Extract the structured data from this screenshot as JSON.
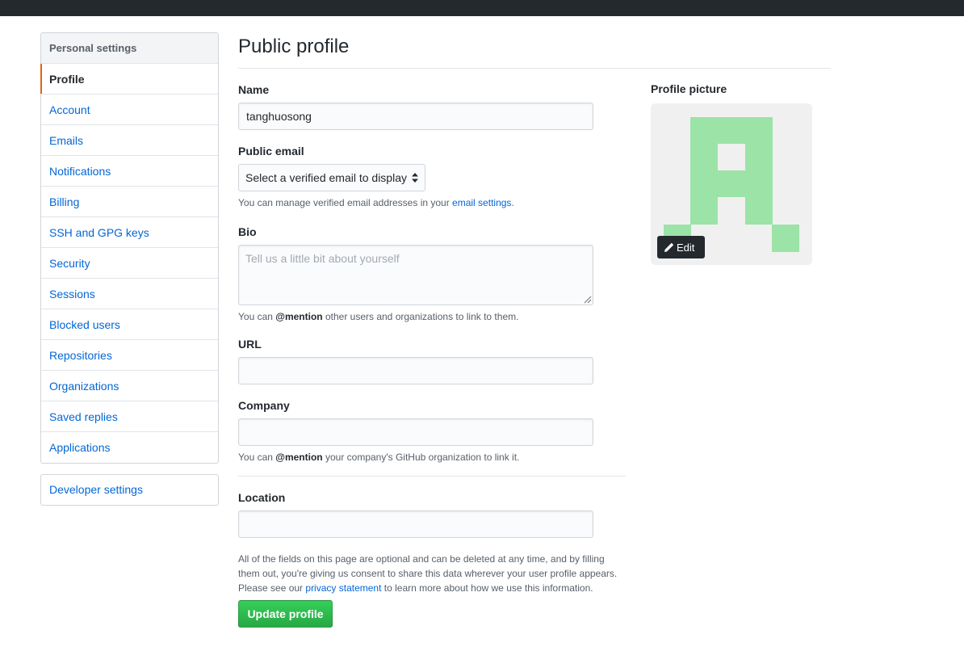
{
  "sidebar": {
    "heading": "Personal settings",
    "items": [
      {
        "label": "Profile"
      },
      {
        "label": "Account"
      },
      {
        "label": "Emails"
      },
      {
        "label": "Notifications"
      },
      {
        "label": "Billing"
      },
      {
        "label": "SSH and GPG keys"
      },
      {
        "label": "Security"
      },
      {
        "label": "Sessions"
      },
      {
        "label": "Blocked users"
      },
      {
        "label": "Repositories"
      },
      {
        "label": "Organizations"
      },
      {
        "label": "Saved replies"
      },
      {
        "label": "Applications"
      }
    ],
    "developer_settings": "Developer settings"
  },
  "main": {
    "title": "Public profile",
    "name": {
      "label": "Name",
      "value": "tanghuosong"
    },
    "public_email": {
      "label": "Public email",
      "selected": "Select a verified email to display",
      "note_prefix": "You can manage verified email addresses in your ",
      "note_link": "email settings",
      "note_suffix": "."
    },
    "bio": {
      "label": "Bio",
      "placeholder": "Tell us a little bit about yourself",
      "note_prefix": "You can ",
      "note_mention": "@mention",
      "note_suffix": " other users and organizations to link to them."
    },
    "url": {
      "label": "URL",
      "value": ""
    },
    "company": {
      "label": "Company",
      "value": "",
      "note_prefix": "You can ",
      "note_mention": "@mention",
      "note_suffix": " your company's GitHub organization to link it."
    },
    "location": {
      "label": "Location",
      "value": ""
    },
    "footer": {
      "text_before": "All of the fields on this page are optional and can be deleted at any time, and by filling them out, you're giving us consent to share this data wherever your user profile appears. Please see our ",
      "link": "privacy statement",
      "text_after": " to learn more about how we use this information."
    },
    "update_button": "Update profile"
  },
  "profile_picture": {
    "label": "Profile picture",
    "edit_button": "Edit",
    "avatar_color": "#9be3a7",
    "edit_icon": "pencil-icon"
  },
  "colors": {
    "link": "#0366d6",
    "selected_accent": "#e36209",
    "topbar": "#24292e",
    "button_green": "#2ea44f"
  }
}
